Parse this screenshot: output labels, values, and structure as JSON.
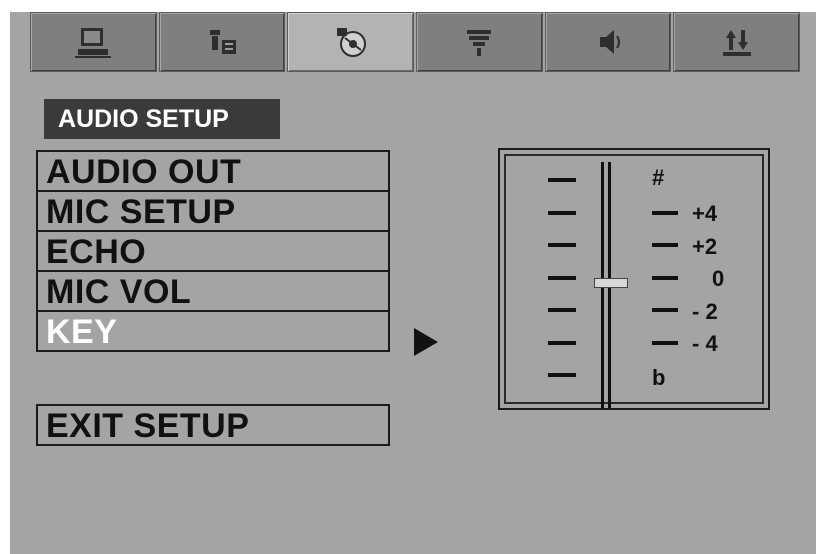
{
  "tabs": [
    {
      "icon": "general-setup-icon",
      "active": false
    },
    {
      "icon": "language-setup-icon",
      "active": false
    },
    {
      "icon": "audio-disc-icon",
      "active": true
    },
    {
      "icon": "video-setup-icon",
      "active": false
    },
    {
      "icon": "speaker-icon",
      "active": false
    },
    {
      "icon": "preference-icon",
      "active": false
    }
  ],
  "section_title": "AUDIO SETUP",
  "menu": {
    "items": [
      "AUDIO OUT",
      "MIC SETUP",
      "ECHO",
      "MIC VOL",
      "KEY"
    ],
    "selected_index": 4,
    "exit_label": "EXIT SETUP"
  },
  "key_panel": {
    "top_label": "#",
    "bottom_label": "b",
    "levels": [
      "+4",
      "+2",
      "0",
      "- 2",
      "- 4"
    ],
    "current_value": "0"
  },
  "colors": {
    "screen_bg": "#a4a4a4",
    "title_bg": "#3b3b3b",
    "selected_text": "#ffffff"
  }
}
